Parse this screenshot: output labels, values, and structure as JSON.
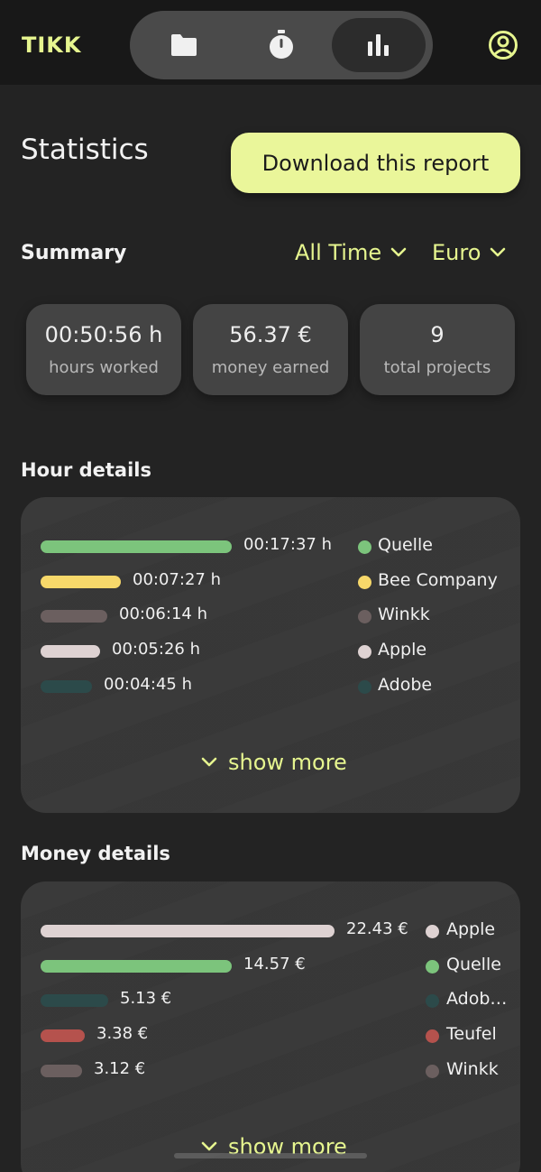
{
  "app": {
    "logo": "TIKK"
  },
  "nav": {
    "items": [
      {
        "name": "projects",
        "icon": "folder-icon",
        "active": false
      },
      {
        "name": "timer",
        "icon": "stopwatch-icon",
        "active": false
      },
      {
        "name": "statistics",
        "icon": "bar-chart-icon",
        "active": true
      }
    ],
    "profile_icon": "user-circle-icon"
  },
  "page": {
    "title": "Statistics",
    "download_label": "Download this report"
  },
  "summary": {
    "label": "Summary",
    "time_filter": "All Time",
    "currency_filter": "Euro",
    "cards": [
      {
        "value": "00:50:56 h",
        "label": "hours worked"
      },
      {
        "value": "56.37 €",
        "label": "money earned"
      },
      {
        "value": "9",
        "label": "total projects"
      }
    ]
  },
  "hour_details": {
    "title": "Hour details",
    "show_more": "show more",
    "items": [
      {
        "value": "00:17:37 h",
        "project": "Quelle",
        "color": "#7cc47c",
        "fraction": 1.0
      },
      {
        "value": "00:07:27 h",
        "project": "Bee Company",
        "color": "#f7d86a",
        "fraction": 0.42
      },
      {
        "value": "00:06:14 h",
        "project": "Winkk",
        "color": "#6b5f5f",
        "fraction": 0.35
      },
      {
        "value": "00:05:26 h",
        "project": "Apple",
        "color": "#ded2d2",
        "fraction": 0.31
      },
      {
        "value": "00:04:45 h",
        "project": "Adobe",
        "color": "#2c4a4a",
        "fraction": 0.27
      }
    ]
  },
  "money_details": {
    "title": "Money details",
    "show_more": "show more",
    "items": [
      {
        "value": "22.43 €",
        "project": "Apple",
        "color": "#ded2d2",
        "fraction": 1.0
      },
      {
        "value": "14.57 €",
        "project": "Quelle",
        "color": "#7cc47c",
        "fraction": 0.65
      },
      {
        "value": "5.13 €",
        "project": "Adob…",
        "color": "#2c4a4a",
        "fraction": 0.23
      },
      {
        "value": "3.38 €",
        "project": "Teufel",
        "color": "#b5524d",
        "fraction": 0.15
      },
      {
        "value": "3.12 €",
        "project": "Winkk",
        "color": "#6b5f5f",
        "fraction": 0.14
      }
    ]
  }
}
